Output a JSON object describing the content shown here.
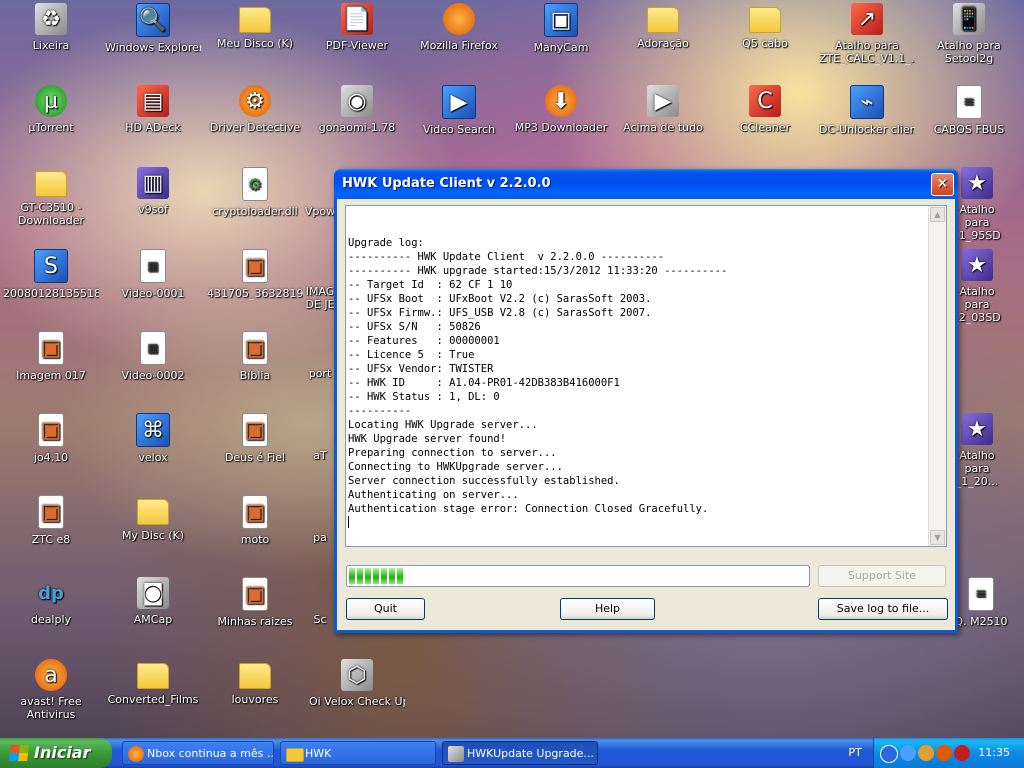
{
  "desktop": {
    "icons": [
      {
        "label": "Lixeira",
        "icon": "recycle-bin-icon"
      },
      {
        "label": "Windows Explorer",
        "icon": "explorer-icon"
      },
      {
        "label": "Meu Disco (K)",
        "icon": "folder-icon"
      },
      {
        "label": "PDF-Viewer",
        "icon": "pdf-icon"
      },
      {
        "label": "Mozilla Firefox",
        "icon": "firefox-icon"
      },
      {
        "label": "ManyCam",
        "icon": "manycam-icon"
      },
      {
        "label": "Adoração",
        "icon": "folder-icon"
      },
      {
        "label": "Q5 cabo",
        "icon": "folder-icon"
      },
      {
        "label": "Atalho para ZTE_CALC_V1.1_...",
        "icon": "shortcut-icon"
      },
      {
        "label": "Atalho para Setool2g",
        "icon": "phone-icon"
      },
      {
        "label": "µTorrent",
        "icon": "utorrent-icon"
      },
      {
        "label": "HD ADeck",
        "icon": "app-icon"
      },
      {
        "label": "Driver Detective",
        "icon": "app-icon"
      },
      {
        "label": "gonaomi-1.78",
        "icon": "app-icon"
      },
      {
        "label": "Video Search",
        "icon": "app-icon"
      },
      {
        "label": "MP3 Downloader",
        "icon": "download-icon"
      },
      {
        "label": "Acima de tudo",
        "icon": "media-icon"
      },
      {
        "label": "CCleaner",
        "icon": "ccleaner-icon"
      },
      {
        "label": "DC-Unlocker client",
        "icon": "usb-icon"
      },
      {
        "label": "CABOS FBUS",
        "icon": "document-icon"
      },
      {
        "label": "GT-C3510 - Downloader",
        "icon": "folder-icon"
      },
      {
        "label": "v9sof",
        "icon": "archive-icon"
      },
      {
        "label": "cryptoloader.dll",
        "icon": "gear-icon"
      },
      {
        "label": "Vpow",
        "icon": "app-icon"
      },
      {
        "label": "Atalho para _1_95SD",
        "icon": "shortcut-icon"
      },
      {
        "label": "20080128135518...",
        "icon": "app-icon"
      },
      {
        "label": "Video-0001",
        "icon": "video-icon"
      },
      {
        "label": "431705_3632819...",
        "icon": "image-icon"
      },
      {
        "label": "IMAG DE JE",
        "icon": "image-icon"
      },
      {
        "label": "Atalho para _2_03SD",
        "icon": "shortcut-icon"
      },
      {
        "label": "Imagem 017",
        "icon": "image-icon"
      },
      {
        "label": "Video-0002",
        "icon": "video-icon"
      },
      {
        "label": "Bíblia",
        "icon": "image-icon"
      },
      {
        "label": "port",
        "icon": "app-icon"
      },
      {
        "label": "jo4.10",
        "icon": "image-icon"
      },
      {
        "label": "velox",
        "icon": "network-icon"
      },
      {
        "label": "Deus é Fiel",
        "icon": "image-icon"
      },
      {
        "label": "aT",
        "icon": "app-icon"
      },
      {
        "label": "Atalho para _1_20...",
        "icon": "shortcut-icon"
      },
      {
        "label": "ZTC e8",
        "icon": "image-icon"
      },
      {
        "label": "My Disc (K)",
        "icon": "folder-icon"
      },
      {
        "label": "moto",
        "icon": "image-icon"
      },
      {
        "label": "pa",
        "icon": "app-icon"
      },
      {
        "label": "dealply",
        "icon": "dealply-icon"
      },
      {
        "label": "AMCap",
        "icon": "camera-icon"
      },
      {
        "label": "Minhas raizes",
        "icon": "image-icon"
      },
      {
        "label": "Sc",
        "icon": "app-icon"
      },
      {
        "label": "Q. M2510",
        "icon": "document-icon"
      },
      {
        "label": "avast! Free Antivirus",
        "icon": "avast-icon"
      },
      {
        "label": "Converted_Films",
        "icon": "folder-icon"
      },
      {
        "label": "louvores",
        "icon": "folder-icon"
      },
      {
        "label": "Oi Velox Check Up",
        "icon": "app-icon"
      }
    ]
  },
  "window": {
    "title": "HWK Update Client  v 2.2.0.0",
    "log_lines": [
      "Upgrade log:",
      "---------- HWK Update Client  v 2.2.0.0 ----------",
      "---------- HWK upgrade started:15/3/2012 11:33:20 ----------",
      "-- Target Id  : 62 CF 1 10",
      "-- UFSx Boot  : UFxBoot V2.2 (c) SarasSoft 2003.",
      "-- UFSx Firmw.: UFS_USB V2.8 (c) SarasSoft 2007.",
      "-- UFSx S/N   : 50826",
      "-- Features   : 00000001",
      "-- Licence 5  : True",
      "-- UFSx Vendor: TWISTER",
      "-- HWK ID     : A1.04-PR01-42DB383B416000F1",
      "-- HWK Status : 1, DL: 0",
      "----------",
      "Locating HWK Upgrade server...",
      "HWK Upgrade server found!",
      "Preparing connection to server...",
      "Connecting to HWKUpgrade server...",
      "Server connection successfully established.",
      "Authenticating on server...",
      "Authentication stage error: Connection Closed Gracefully."
    ],
    "progress_fraction": 0.1,
    "buttons": {
      "support_site": "Support Site",
      "quit": "Quit",
      "help": "Help",
      "save_log": "Save log to file..."
    }
  },
  "taskbar": {
    "start_label": "Iniciar",
    "tasks": [
      {
        "label": "Nbox continua a mês ...",
        "icon": "firefox-icon"
      },
      {
        "label": "HWK",
        "icon": "folder-icon"
      },
      {
        "label": "HWKUpdate Upgrade...",
        "icon": "app-icon"
      }
    ],
    "language": "PT",
    "clock": "11:35"
  }
}
